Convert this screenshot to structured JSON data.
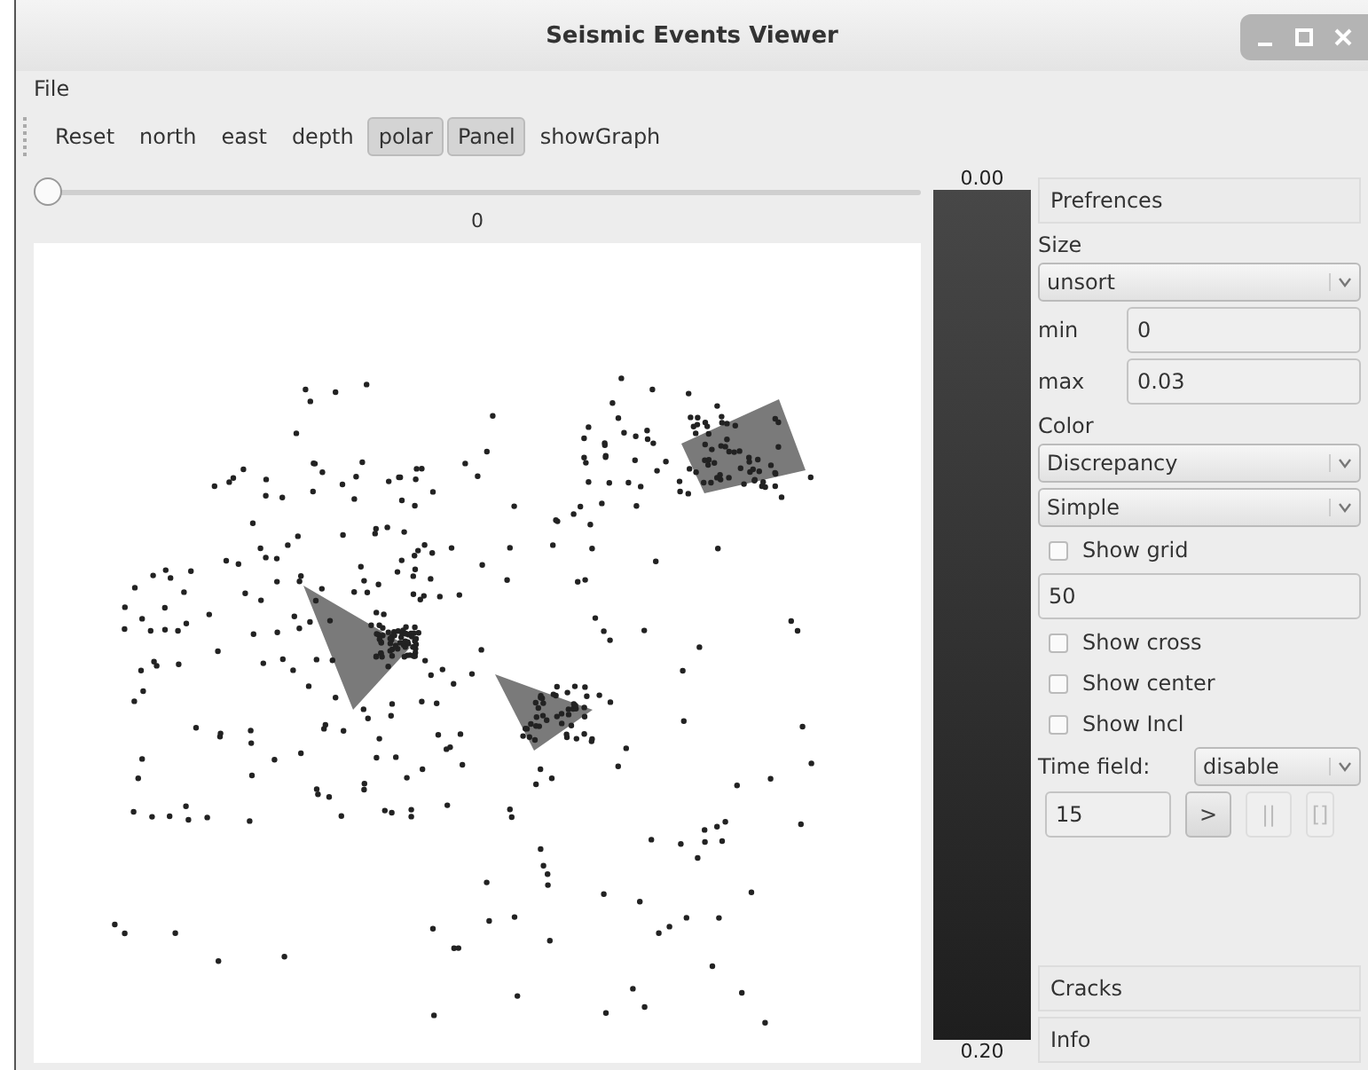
{
  "window": {
    "title": "Seismic Events Viewer"
  },
  "menu": [
    "File"
  ],
  "toolbar": [
    {
      "label": "Reset",
      "selected": false
    },
    {
      "label": "north",
      "selected": false
    },
    {
      "label": "east",
      "selected": false
    },
    {
      "label": "depth",
      "selected": false
    },
    {
      "label": "polar",
      "selected": true
    },
    {
      "label": "Panel",
      "selected": true
    },
    {
      "label": "showGraph",
      "selected": false
    }
  ],
  "slider": {
    "level": 0,
    "reading": "0"
  },
  "colorbar": {
    "top_label": "0.00",
    "bottom_label": "0.20"
  },
  "panel": {
    "header": "Prefrences",
    "size_label": "Size",
    "size_select": "unsort",
    "min_label": "min",
    "min_value": "0",
    "max_label": "max",
    "max_value": "0.03",
    "color_label": "Color",
    "color_select": "Discrepancy",
    "scheme_select": "Simple",
    "show_grid": {
      "label": "Show grid",
      "checked": false
    },
    "grid_value": "50",
    "options": [
      {
        "label": "Show cross",
        "checked": false
      },
      {
        "label": "Show center",
        "checked": false
      },
      {
        "label": "Show Incl",
        "checked": false
      }
    ],
    "time_label": "Time field:",
    "time_select": "disable",
    "time_value": "15",
    "play_buttons": [
      {
        "label": ">",
        "disabled": false
      },
      {
        "label": "||",
        "disabled": true
      },
      {
        "label": "[]",
        "disabled": true
      }
    ],
    "sections": [
      "Cracks",
      "Info"
    ]
  }
}
